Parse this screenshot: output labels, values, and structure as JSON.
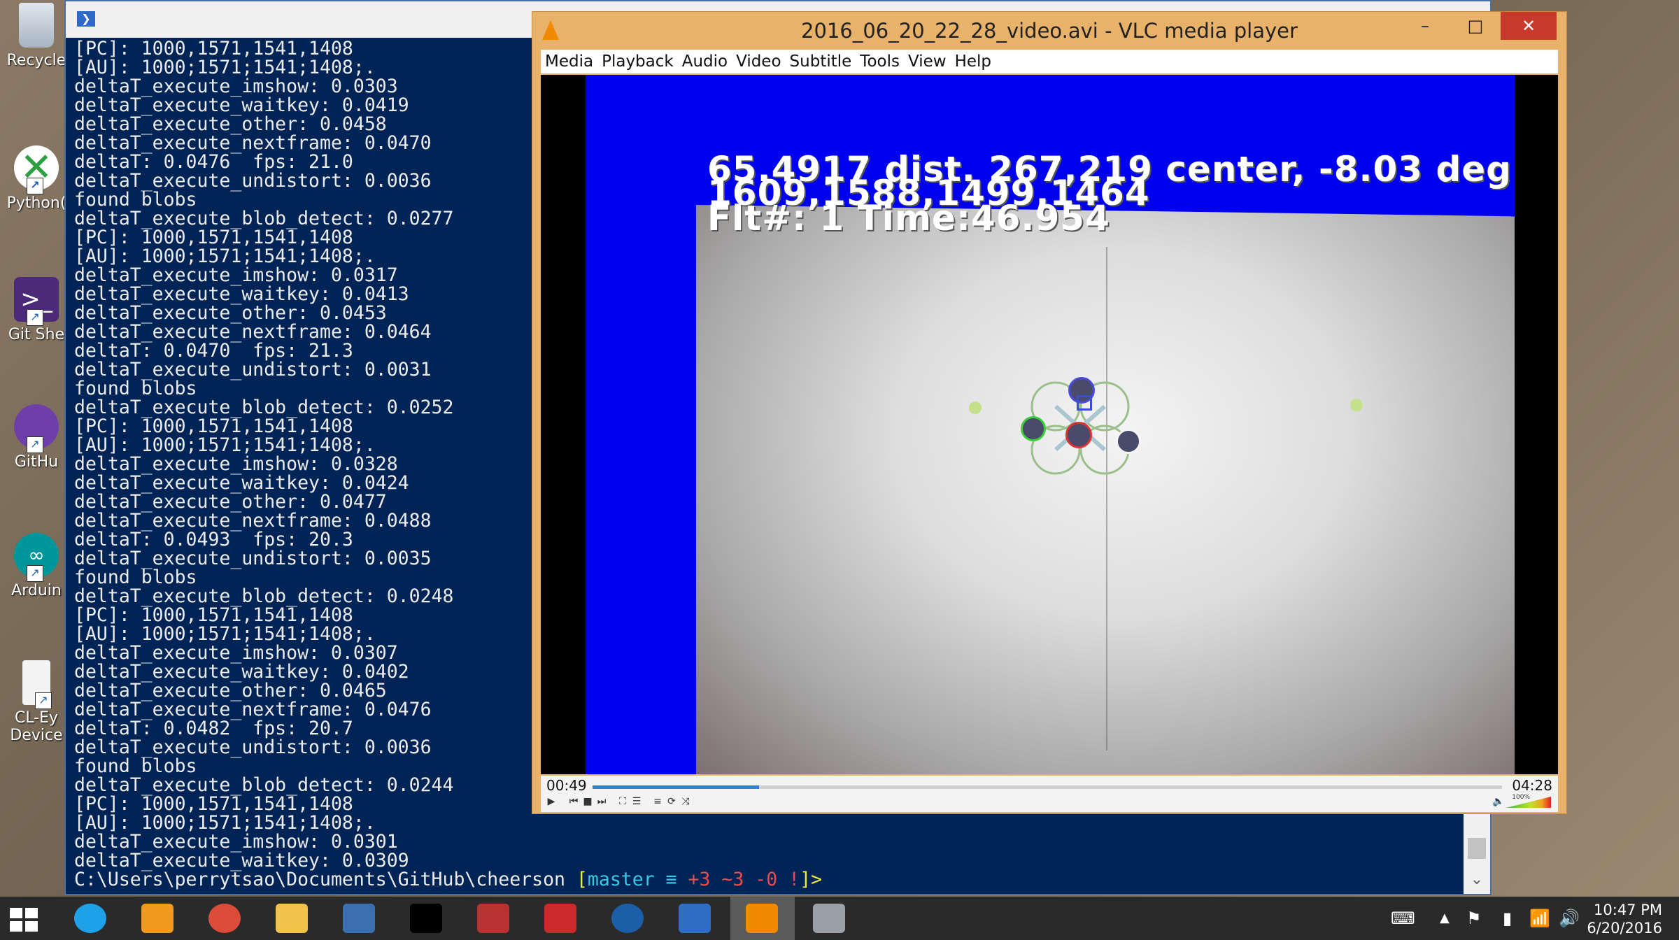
{
  "desktop": {
    "icons": [
      {
        "label": "Recycle",
        "icon": "recycle-bin-icon"
      },
      {
        "label": "Python(",
        "icon": "python-icon"
      },
      {
        "label": "Git She",
        "icon": "git-shell-icon"
      },
      {
        "label": "GitHu",
        "icon": "github-icon"
      },
      {
        "label": "Arduin",
        "icon": "arduino-icon"
      },
      {
        "label": "CL-Ey",
        "label2": "Device",
        "icon": "cl-eye-icon"
      }
    ]
  },
  "powershell": {
    "lines": [
      "[PC]: 1000,1571,1541,1408",
      "[AU]: 1000;1571;1541;1408;.",
      "deltaT_execute_imshow: 0.0303",
      "deltaT_execute_waitkey: 0.0419",
      "deltaT_execute_other: 0.0458",
      "deltaT_execute_nextframe: 0.0470",
      "deltaT: 0.0476  fps: 21.0",
      "deltaT_execute_undistort: 0.0036",
      "found blobs",
      "deltaT_execute_blob_detect: 0.0277",
      "[PC]: 1000,1571,1541,1408",
      "[AU]: 1000;1571;1541;1408;.",
      "deltaT_execute_imshow: 0.0317",
      "deltaT_execute_waitkey: 0.0413",
      "deltaT_execute_other: 0.0453",
      "deltaT_execute_nextframe: 0.0464",
      "deltaT: 0.0470  fps: 21.3",
      "deltaT_execute_undistort: 0.0031",
      "found blobs",
      "deltaT_execute_blob_detect: 0.0252",
      "[PC]: 1000,1571,1541,1408",
      "[AU]: 1000;1571;1541;1408;.",
      "deltaT_execute_imshow: 0.0328",
      "deltaT_execute_waitkey: 0.0424",
      "deltaT_execute_other: 0.0477",
      "deltaT_execute_nextframe: 0.0488",
      "deltaT: 0.0493  fps: 20.3",
      "deltaT_execute_undistort: 0.0035",
      "found blobs",
      "deltaT_execute_blob_detect: 0.0248",
      "[PC]: 1000,1571,1541,1408",
      "[AU]: 1000;1571;1541;1408;.",
      "deltaT_execute_imshow: 0.0307",
      "deltaT_execute_waitkey: 0.0402",
      "deltaT_execute_other: 0.0465",
      "deltaT_execute_nextframe: 0.0476",
      "deltaT: 0.0482  fps: 20.7",
      "deltaT_execute_undistort: 0.0036",
      "found blobs",
      "deltaT_execute_blob_detect: 0.0244",
      "[PC]: 1000,1571,1541,1408",
      "[AU]: 1000;1571;1541;1408;.",
      "deltaT_execute_imshow: 0.0301",
      "deltaT_execute_waitkey: 0.0309"
    ],
    "prompt": {
      "path": "C:\\Users\\perrytsao\\Documents\\GitHub\\cheerson ",
      "open_bracket": "[",
      "branch": "master ≡ ",
      "added": "+3 ",
      "modified": "~3 ",
      "deleted": "-0 ",
      "bang": "!",
      "close": "]>"
    },
    "colors": {
      "background": "#012456",
      "text": "#ececec"
    }
  },
  "vlc": {
    "title": "2016_06_20_22_28_video.avi - VLC media player",
    "window_buttons": {
      "minimize": "–",
      "maximize": "□",
      "close": "✕"
    },
    "menu": [
      "Media",
      "Playback",
      "Audio",
      "Video",
      "Subtitle",
      "Tools",
      "View",
      "Help"
    ],
    "overlay": {
      "line1": "65.4917 dist. 267,219 center, -8.03 deg",
      "line2": "1609,1588,1499,1464",
      "line3": "Flt#: 1 Time:46.954"
    },
    "elapsed": "00:49",
    "total": "04:28",
    "progress": 0.183,
    "volume_label": "100%",
    "colors": {
      "accent": "#f18a00",
      "video_bg": "#0000f0",
      "seek": "#2f7fe0"
    }
  },
  "taskbar": {
    "apps": [
      {
        "name": "internet-explorer",
        "color": "#1ea1e6"
      },
      {
        "name": "greenshot",
        "color": "#f39a1e"
      },
      {
        "name": "chrome",
        "color": "#dd4b39"
      },
      {
        "name": "file-explorer",
        "color": "#f3c24a"
      },
      {
        "name": "python-idle",
        "color": "#3a6fb0"
      },
      {
        "name": "command-prompt",
        "color": "#000000"
      },
      {
        "name": "network-app",
        "color": "#b83232"
      },
      {
        "name": "altium",
        "color": "#cc2a2a"
      },
      {
        "name": "sourcetree",
        "color": "#1a5fa8"
      },
      {
        "name": "powershell",
        "color": "#2f6dc7"
      },
      {
        "name": "vlc",
        "color": "#f18a00"
      },
      {
        "name": "paint",
        "color": "#9aa0a6"
      }
    ],
    "clock_time": "10:47 PM",
    "clock_date": "6/20/2016"
  }
}
